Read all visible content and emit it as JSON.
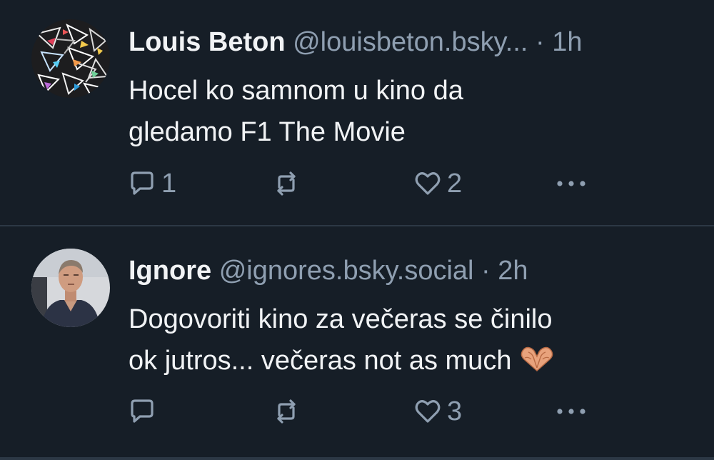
{
  "posts": [
    {
      "display_name": "Louis Beton",
      "handle": "@louisbeton.bsky...",
      "separator": "·",
      "time": "1h",
      "text": "Hocel ko samnom u kino da\ngledamo F1 The Movie",
      "emoji": "",
      "reply_count": "1",
      "repost_count": "",
      "like_count": "2"
    },
    {
      "display_name": "Ignore",
      "handle": "@ignores.bsky.social",
      "separator": "·",
      "time": "2h",
      "text": "Dogovoriti kino za večeras se činilo\nok jutros... večeras not as much",
      "emoji": "heart-hands",
      "reply_count": "",
      "repost_count": "",
      "like_count": "3"
    }
  ],
  "icons": {
    "reply": "reply-icon",
    "repost": "repost-icon",
    "like": "heart-icon",
    "more": "more-icon"
  },
  "colors": {
    "background": "#161e27",
    "text": "#f1f3f5",
    "muted": "#8f9fb1",
    "divider": "#2c3845"
  }
}
